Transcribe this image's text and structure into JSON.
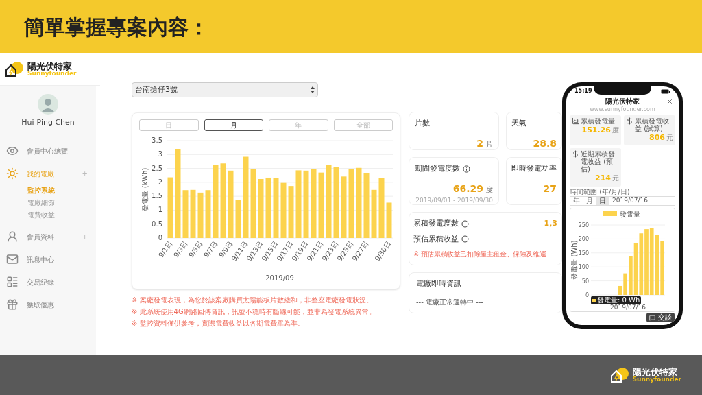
{
  "slide": {
    "title": "簡單掌握專案內容：",
    "footer_logo": {
      "name": "陽光伏特家",
      "sub": "Sunnyfounder"
    }
  },
  "site": {
    "logo": {
      "name": "陽光伏特家",
      "sub": "Sunnyfounder"
    },
    "user": {
      "name": "Hui-Ping Chen"
    },
    "nav": [
      {
        "kind": "overview",
        "label": "會員中心總覽",
        "selected": false
      },
      {
        "kind": "plant",
        "label": "我的電廠",
        "selected": true,
        "toggle": "+",
        "children": [
          {
            "label": "監控系統",
            "selected": true
          },
          {
            "label": "電廠細節",
            "selected": false
          },
          {
            "label": "電費收益",
            "selected": false
          }
        ]
      },
      {
        "kind": "member",
        "label": "會員資料",
        "selected": false,
        "toggle": "+"
      },
      {
        "kind": "mail",
        "label": "訊息中心",
        "selected": false
      },
      {
        "kind": "records",
        "label": "交易紀錄",
        "selected": false
      },
      {
        "kind": "offer",
        "label": "獲取優惠",
        "selected": false
      }
    ],
    "plant_select": {
      "value": "台南搶仔3號"
    },
    "tabs": [
      {
        "label": "日",
        "selected": false
      },
      {
        "label": "月",
        "selected": true
      },
      {
        "label": "年",
        "selected": false
      },
      {
        "label": "全部",
        "selected": false
      }
    ],
    "chart_data": {
      "type": "bar",
      "xlabel": "2019/09",
      "ylabel": "發電量 (kWh)",
      "grid": true,
      "categories": [
        "9/1日",
        null,
        "9/3日",
        null,
        "9/5日",
        null,
        "9/7日",
        null,
        "9/9日",
        null,
        "9/11日",
        null,
        "9/13日",
        null,
        "9/15日",
        null,
        "9/17日",
        null,
        "9/19日",
        null,
        "9/21日",
        null,
        "9/23日",
        null,
        "9/25日",
        null,
        "9/27日",
        null,
        null,
        "9/30日"
      ],
      "series": [
        {
          "color": "#fcd34d",
          "values": [
            2.18,
            3.2,
            1.72,
            1.73,
            1.63,
            1.72,
            2.63,
            2.68,
            2.42,
            1.37,
            2.92,
            2.47,
            2.12,
            2.17,
            2.15,
            1.98,
            1.87,
            2.43,
            2.42,
            2.47,
            2.35,
            2.62,
            2.55,
            2.21,
            2.49,
            2.52,
            2.33,
            1.73,
            2.16,
            1.27
          ]
        }
      ],
      "ylim": [
        0,
        3.5
      ],
      "yticks": [
        0,
        0.5,
        1,
        1.5,
        2,
        2.5,
        3,
        3.5
      ]
    },
    "notes": [
      "※ 案廠發電表現，為您於該案廠購買太陽能板片數總和，非整座電廠發電狀況。",
      "※ 此系統使用4G網路回傳資訊，訊號不穩時有斷線可能，並非為發電系統異常。",
      "※ 監控資料僅供參考，實際電費收益以各期電費單為準。"
    ],
    "cards": [
      {
        "kind": "stat",
        "title": "片數",
        "value": "2",
        "unit": "片"
      },
      {
        "kind": "stat",
        "title": "天氣",
        "value": "28.8"
      },
      {
        "kind": "stat",
        "title": "期間發電度數",
        "info": true,
        "value": "66.29",
        "unit": "度",
        "sub": "2019/09/01 - 2019/09/30"
      },
      {
        "kind": "stat",
        "title": "即時發電功率",
        "value": "27"
      }
    ],
    "totals": {
      "rows": [
        {
          "label": "累積發電度數",
          "value": "1,3"
        },
        {
          "label": "預估累積收益"
        }
      ],
      "note": "※ 預估累積收益已扣除屋主租金、保險及維運"
    },
    "live": {
      "title": "電廠即時資訊",
      "status": "--- 電廠正常運轉中 ---"
    }
  },
  "phone": {
    "time": "15:19",
    "title": "陽光伏特家",
    "url": "www.sunnyfounder.com",
    "cards": [
      {
        "kind": "chart",
        "label": "累積發電量",
        "value": "151.26",
        "unit": "度"
      },
      {
        "kind": "money",
        "label": "累積發電收益 (試算)",
        "value": "806",
        "unit": "元"
      },
      {
        "kind": "money",
        "label": "近期累積發電收益 (預估)",
        "value": "214",
        "unit": "元"
      }
    ],
    "range_label": "時間範圍 (年/月/日)",
    "range_tabs": [
      {
        "label": "年",
        "selected": false
      },
      {
        "label": "月",
        "selected": false
      },
      {
        "label": "日",
        "selected": true
      }
    ],
    "date_value": "2019/07/16",
    "chart_data": {
      "type": "bar",
      "ylabel": "發電量 (Wh)",
      "grid": true,
      "xlabel": "2019/07/16",
      "ylim": [
        0,
        250
      ],
      "yticks": [
        0,
        50,
        100,
        150,
        200,
        250
      ],
      "series": [
        {
          "name": "發電量",
          "color": "#fcd34d",
          "values": [
            0,
            0,
            0,
            0,
            0,
            32,
            77,
            138,
            185,
            220,
            235,
            238,
            215,
            193
          ]
        }
      ]
    },
    "tooltip": "發電量: 0 Wh",
    "chat_button": "交談"
  }
}
